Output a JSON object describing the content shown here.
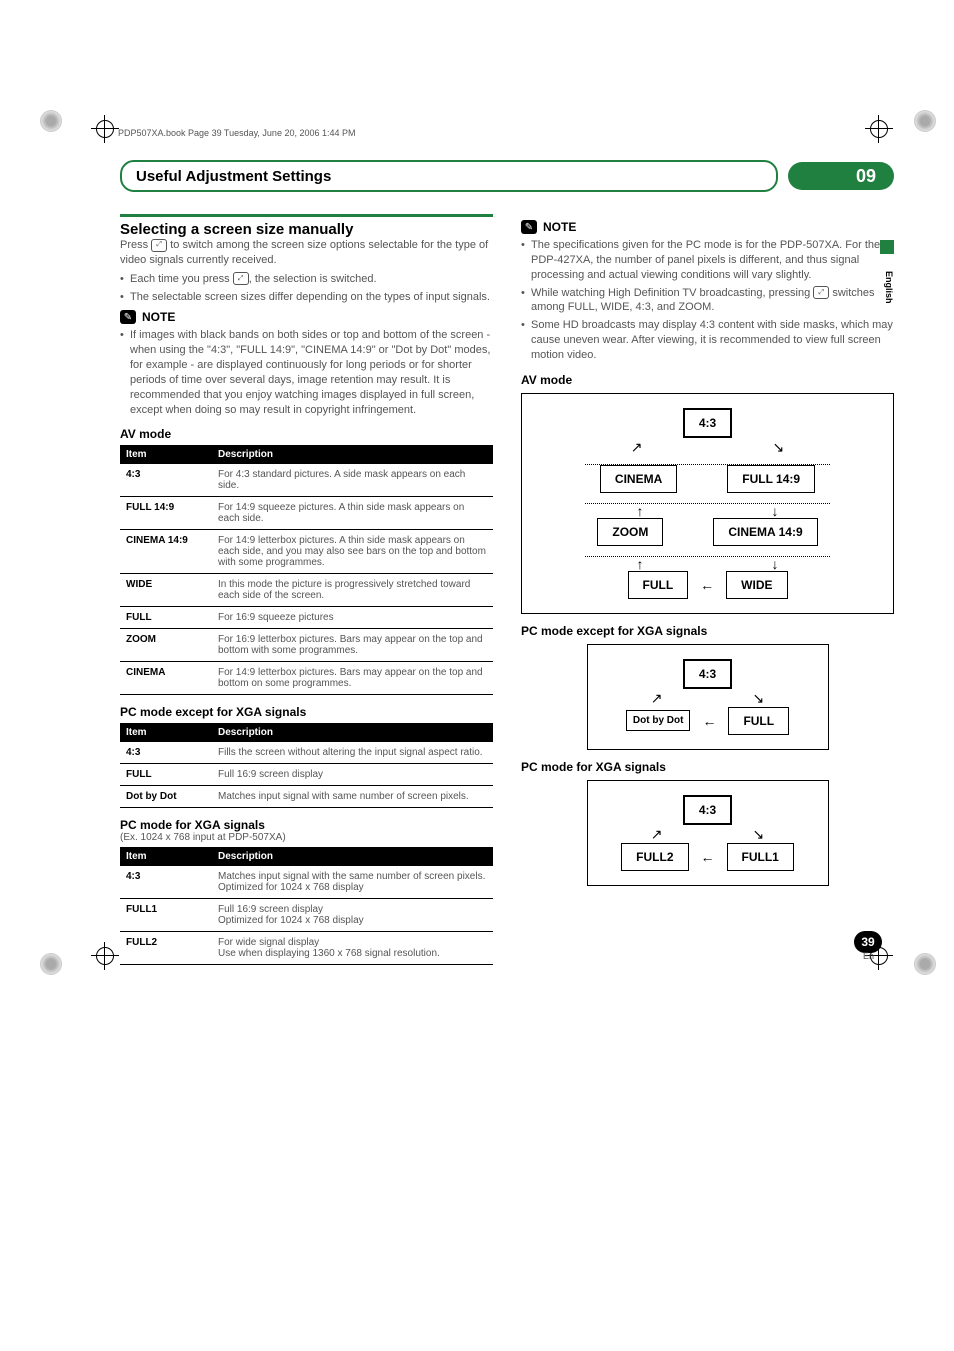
{
  "bookmark": "PDP507XA.book  Page 39  Tuesday, June 20, 2006  1:44 PM",
  "title": "Useful Adjustment Settings",
  "chapter": "09",
  "lang_tab": "English",
  "left": {
    "section_head": "Selecting a screen size manually",
    "intro": "Press ⤢ to switch among the screen size options selectable for the type of video signals currently received.",
    "bullets": [
      "Each time you press ⤢, the selection is switched.",
      "The selectable screen sizes differ depending on the types of input signals."
    ],
    "note_label": "NOTE",
    "note_bullets": [
      "If images with black bands on both sides or top and bottom of the screen - when using the \"4:3\", \"FULL 14:9\", \"CINEMA 14:9\" or \"Dot by Dot\" modes, for example - are displayed continuously for long periods or for shorter periods of time over several days, image retention may result. It is recommended that you enjoy watching images displayed in full screen, except when doing so may result in copyright infringement."
    ],
    "av_mode_head": "AV mode",
    "table_av": {
      "headers": [
        "Item",
        "Description"
      ],
      "rows": [
        [
          "4:3",
          "For 4:3 standard pictures. A side mask appears on each side."
        ],
        [
          "FULL 14:9",
          "For 14:9 squeeze pictures. A thin side mask appears on each side."
        ],
        [
          "CINEMA 14:9",
          "For 14:9 letterbox pictures. A thin side mask appears on each side, and you may also see bars on the top and bottom with some programmes."
        ],
        [
          "WIDE",
          "In this mode the picture is progressively stretched toward each side of the screen."
        ],
        [
          "FULL",
          "For 16:9 squeeze pictures"
        ],
        [
          "ZOOM",
          "For 16:9 letterbox pictures. Bars may appear on the top and bottom with some programmes."
        ],
        [
          "CINEMA",
          "For 14:9 letterbox pictures. Bars may appear on the top and bottom on some programmes."
        ]
      ]
    },
    "pc_head": "PC mode except for XGA signals",
    "table_pc": {
      "headers": [
        "Item",
        "Description"
      ],
      "rows": [
        [
          "4:3",
          "Fills the screen without altering the input signal aspect ratio."
        ],
        [
          "FULL",
          "Full 16:9 screen display"
        ],
        [
          "Dot by Dot",
          "Matches input signal with same number of screen pixels."
        ]
      ]
    },
    "xga_head": "PC mode for XGA signals",
    "xga_note": "(Ex. 1024 x 768 input at PDP-507XA)",
    "table_xga": {
      "headers": [
        "Item",
        "Description"
      ],
      "rows": [
        [
          "4:3",
          "Matches input signal with the same number of screen pixels.\nOptimized for 1024 x 768 display"
        ],
        [
          "FULL1",
          "Full 16:9 screen display\nOptimized for 1024 x 768 display"
        ],
        [
          "FULL2",
          "For wide signal display\nUse when displaying 1360 x 768 signal resolution."
        ]
      ]
    }
  },
  "right": {
    "note_label": "NOTE",
    "note_bullets": [
      "The specifications given for the PC mode is for the PDP-507XA. For the PDP-427XA, the number of panel pixels is different, and thus signal processing and actual viewing conditions will vary slightly.",
      "While watching High Definition TV broadcasting, pressing ⤢ switches among FULL, WIDE, 4:3, and ZOOM.",
      "Some HD broadcasts may display 4:3 content with side masks, which may cause uneven wear.  After viewing, it is recommended to view full screen motion video."
    ],
    "av_mode_head": "AV mode",
    "pc_head": "PC mode except for XGA signals",
    "xga_head": "PC mode for XGA signals",
    "diag_av": {
      "top": "4:3",
      "mid_l": "CINEMA",
      "mid_r": "FULL 14:9",
      "low_l": "ZOOM",
      "low_r": "CINEMA 14:9",
      "bot_l": "FULL",
      "bot_r": "WIDE"
    },
    "diag_pc": {
      "top": "4:3",
      "bl": "Dot by Dot",
      "br": "FULL"
    },
    "diag_xga": {
      "top": "4:3",
      "bl": "FULL2",
      "br": "FULL1"
    }
  },
  "page_num": "39",
  "page_lang": "En"
}
